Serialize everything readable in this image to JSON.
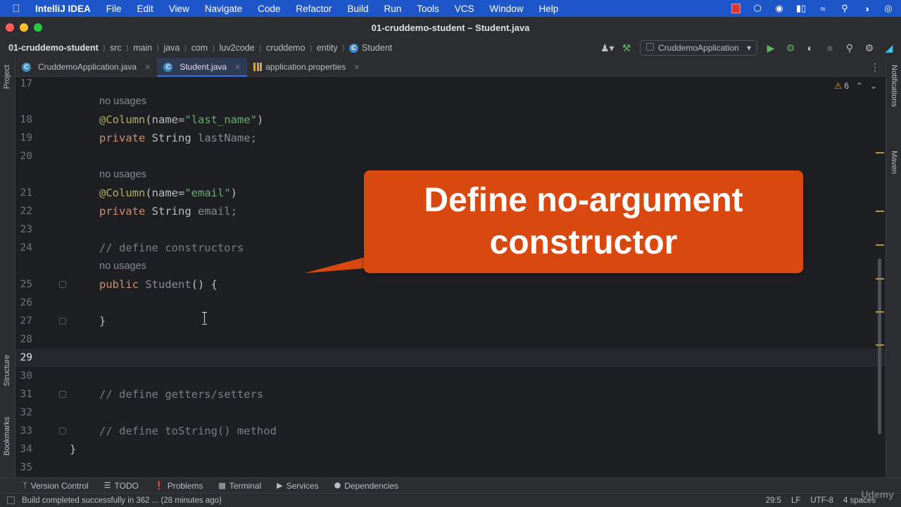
{
  "menubar": {
    "app": "IntelliJ IDEA",
    "items": [
      "File",
      "Edit",
      "View",
      "Navigate",
      "Code",
      "Refactor",
      "Build",
      "Run",
      "Tools",
      "VCS",
      "Window",
      "Help"
    ]
  },
  "window": {
    "title": "01-cruddemo-student – Student.java"
  },
  "breadcrumb": [
    "01-cruddemo-student",
    "src",
    "main",
    "java",
    "com",
    "luv2code",
    "cruddemo",
    "entity",
    "Student"
  ],
  "run_config": "CruddemoApplication",
  "tabs": [
    {
      "label": "CruddemoApplication.java",
      "active": false
    },
    {
      "label": "Student.java",
      "active": true
    },
    {
      "label": "application.properties",
      "active": false
    }
  ],
  "side_tools": {
    "left_top": "Project",
    "left_mid": "Structure",
    "left_bottom": "Bookmarks",
    "right_top": "Notifications",
    "right_mid": "Maven"
  },
  "inspection": {
    "warnings": "6"
  },
  "editor": {
    "hint": "no usages",
    "lines": [
      {
        "n": "17"
      },
      {
        "n": "18",
        "ann": "@Column",
        "open": "(name=",
        "str": "\"last_name\"",
        "close": ")"
      },
      {
        "n": "19",
        "kw": "private",
        "type": "String",
        "field": "lastName;"
      },
      {
        "n": "20"
      },
      {
        "n": "21",
        "ann": "@Column",
        "open": "(name=",
        "str": "\"email\"",
        "close": ")"
      },
      {
        "n": "22",
        "kw": "private",
        "type": "String",
        "field": "email;"
      },
      {
        "n": "23"
      },
      {
        "n": "24",
        "comment": "// define constructors"
      },
      {
        "n": "25",
        "kw": "public",
        "name": "Student",
        "rest": "() {"
      },
      {
        "n": "26"
      },
      {
        "n": "27",
        "code": "}"
      },
      {
        "n": "28"
      },
      {
        "n": "29"
      },
      {
        "n": "30"
      },
      {
        "n": "31",
        "comment": "// define getters/setters"
      },
      {
        "n": "32"
      },
      {
        "n": "33",
        "comment": "// define toString() method"
      },
      {
        "n": "34",
        "code": "}"
      },
      {
        "n": "35"
      }
    ]
  },
  "callout": {
    "line1": "Define no-argument",
    "line2": "constructor"
  },
  "tool_windows": [
    "Version Control",
    "TODO",
    "Problems",
    "Terminal",
    "Services",
    "Dependencies"
  ],
  "status": {
    "message": "Build completed successfully in 362 ... (28 minutes ago)",
    "position": "29:5",
    "line_sep": "LF",
    "encoding": "UTF-8",
    "indent": "4 spaces"
  },
  "watermark": "Udemy",
  "colors": {
    "accent": "#3574f0",
    "callout": "#d9480f",
    "menubar": "#1c56c9"
  }
}
